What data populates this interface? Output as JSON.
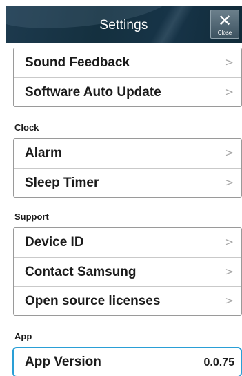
{
  "header": {
    "title": "Settings",
    "close_glyph": "✕",
    "close_label": "Close"
  },
  "groups": [
    {
      "label": "",
      "items": [
        {
          "label": "Sound Feedback",
          "chevron": ">"
        },
        {
          "label": "Software Auto Update",
          "chevron": ">"
        }
      ]
    },
    {
      "label": "Clock",
      "items": [
        {
          "label": "Alarm",
          "chevron": ">"
        },
        {
          "label": "Sleep Timer",
          "chevron": ">"
        }
      ]
    },
    {
      "label": "Support",
      "items": [
        {
          "label": "Device ID",
          "chevron": ">"
        },
        {
          "label": "Contact Samsung",
          "chevron": ">"
        },
        {
          "label": "Open source licenses",
          "chevron": ">"
        }
      ]
    },
    {
      "label": "App",
      "items": [
        {
          "label": "App Version",
          "value": "0.0.75"
        }
      ]
    }
  ]
}
